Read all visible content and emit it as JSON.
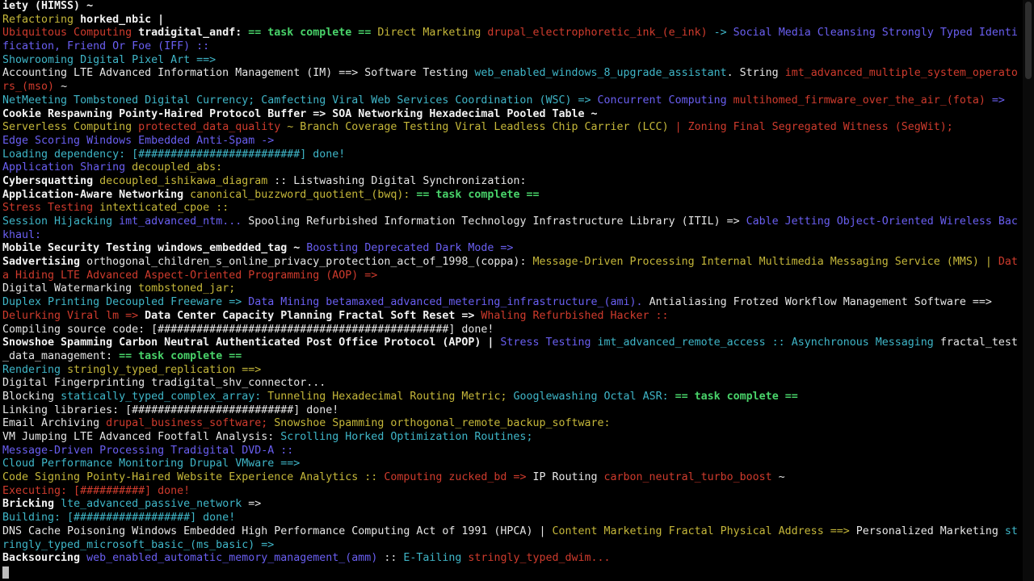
{
  "colors": {
    "W": "#e6e6e6",
    "B": "#f2f2f2",
    "Y": "#c5b73a",
    "R": "#cf3b2d",
    "C": "#3fb6c8",
    "L": "#6a5ff2",
    "G": "#49d36a"
  },
  "lines": [
    [
      [
        "iety (HIMSS) ~",
        "B"
      ]
    ],
    [
      [
        "Refactoring ",
        "Y"
      ],
      [
        "horked_nbic |",
        "B"
      ]
    ],
    [
      [
        "Ubiquitous Computing ",
        "R"
      ],
      [
        "tradigital_andf: ",
        "B"
      ],
      [
        "== task complete == ",
        "G"
      ],
      [
        "Direct Marketing ",
        "Y"
      ],
      [
        "drupal_electrophoretic_ink_(e_ink) ",
        "R"
      ],
      [
        "-> ",
        "C"
      ],
      [
        "Social Media Cleansing Strongly Typed Identi",
        "L"
      ]
    ],
    [
      [
        "fication, Friend Or Foe (IFF) ::",
        "L"
      ]
    ],
    [
      [
        "Showrooming Digital Pixel Art ==>",
        "C"
      ]
    ],
    [
      [
        "Accounting LTE Advanced Information Management (IM) ==> Software Testing ",
        "W"
      ],
      [
        "web_enabled_windows_8_upgrade_assistant",
        "C"
      ],
      [
        ". String ",
        "W"
      ],
      [
        "imt_advanced_multiple_system_operato",
        "R"
      ]
    ],
    [
      [
        "rs_(mso) ",
        "R"
      ],
      [
        "~",
        "W"
      ]
    ],
    [
      [
        "NetMeeting Tombstoned Digital Currency; Camfecting Viral Web Services Coordination (WSC) => ",
        "C"
      ],
      [
        "Concurrent Computing ",
        "L"
      ],
      [
        "multihomed_firmware_over_the_air_(fota) ",
        "R"
      ],
      [
        "=>",
        "L"
      ]
    ],
    [
      [
        "Cookie Respawning Pointy-Haired Protocol Buffer => SOA Networking Hexadecimal Pooled Table ~",
        "B"
      ]
    ],
    [
      [
        "Serverless Computing ",
        "Y"
      ],
      [
        "protected_data_quality ",
        "R"
      ],
      [
        "~ Branch Coverage Testing Viral Leadless Chip Carrier (LCC) ",
        "Y"
      ],
      [
        "| Zoning Final Segregated Witness (SegWit);",
        "R"
      ]
    ],
    [
      [
        "Edge Scoring Windows Embedded Anti-Spam ->",
        "L"
      ]
    ],
    [
      [
        "Loading dependency: [#########################] done!",
        "C"
      ]
    ],
    [
      [
        "Application Sharing ",
        "L"
      ],
      [
        "decoupled_abs:",
        "Y"
      ]
    ],
    [
      [
        "Cybersquatting ",
        "B"
      ],
      [
        "decoupled_ishikawa_diagram ",
        "Y"
      ],
      [
        ":: Listwashing Digital Synchronization:",
        "W"
      ]
    ],
    [
      [
        "Application-Aware Networking ",
        "B"
      ],
      [
        "canonical_buzzword_quotient_(bwq): ",
        "Y"
      ],
      [
        "== task complete ==",
        "G"
      ]
    ],
    [
      [
        "Stress Testing ",
        "R"
      ],
      [
        "intexticated_cpoe ::",
        "Y"
      ]
    ],
    [
      [
        "Session Hijacking ",
        "C"
      ],
      [
        "imt_advanced_ntm... ",
        "L"
      ],
      [
        "Spooling Refurbished Information Technology Infrastructure Library (ITIL) => ",
        "W"
      ],
      [
        "Cable Jetting Object-Oriented Wireless Bac",
        "L"
      ]
    ],
    [
      [
        "khaul:",
        "L"
      ]
    ],
    [
      [
        "Mobile Security Testing windows_embedded_tag ~ ",
        "B"
      ],
      [
        "Boosting Deprecated Dark Mode =>",
        "L"
      ]
    ],
    [
      [
        "Sadvertising ",
        "B"
      ],
      [
        "orthogonal_children_s_online_privacy_protection_act_of_1998_(coppa): ",
        "W"
      ],
      [
        "Message-Driven Processing Internal Multimedia Messaging Service (MMS) | ",
        "Y"
      ],
      [
        "Dat",
        "R"
      ]
    ],
    [
      [
        "a Hiding LTE Advanced Aspect-Oriented Programming (AOP) =>",
        "R"
      ]
    ],
    [
      [
        "Digital Watermarking ",
        "W"
      ],
      [
        "tombstoned_jar;",
        "Y"
      ]
    ],
    [
      [
        "Duplex Printing Decoupled Freeware => ",
        "C"
      ],
      [
        "Data Mining ",
        "L"
      ],
      [
        "betamaxed_advanced_metering_infrastructure_(ami). ",
        "L"
      ],
      [
        "Antialiasing Frotzed Workflow Management Software ==>",
        "W"
      ]
    ],
    [
      [
        "Delurking Viral lm => ",
        "R"
      ],
      [
        "Data Center Capacity Planning Fractal Soft Reset => ",
        "B"
      ],
      [
        "Whaling Refurbished Hacker ::",
        "R"
      ]
    ],
    [
      [
        "Compiling source code: [#############################################] done!",
        "W"
      ]
    ],
    [
      [
        "Snowshoe Spamming Carbon Neutral Authenticated Post Office Protocol (APOP) | ",
        "B"
      ],
      [
        "Stress Testing ",
        "L"
      ],
      [
        "imt_advanced_remote_access :: ",
        "C"
      ],
      [
        "Asynchronous Messaging ",
        "C"
      ],
      [
        "fractal_test",
        "W"
      ]
    ],
    [
      [
        "_data_management: ",
        "W"
      ],
      [
        "== task complete ==",
        "G"
      ]
    ],
    [
      [
        "Rendering ",
        "C"
      ],
      [
        "stringly_typed_replication ==>",
        "Y"
      ]
    ],
    [
      [
        "Digital Fingerprinting tradigital_shv_connector...",
        "W"
      ]
    ],
    [
      [
        "Blocking ",
        "W"
      ],
      [
        "statically_typed_complex_array: ",
        "C"
      ],
      [
        "Tunneling Hexadecimal Routing Metric; ",
        "Y"
      ],
      [
        "Googlewashing Octal ASR: ",
        "C"
      ],
      [
        "== task complete ==",
        "G"
      ]
    ],
    [
      [
        "Linking libraries: [#########################] done!",
        "W"
      ]
    ],
    [
      [
        "Email Archiving ",
        "W"
      ],
      [
        "drupal_business_software; ",
        "R"
      ],
      [
        "Snowshoe Spamming orthogonal_remote_backup_software:",
        "Y"
      ]
    ],
    [
      [
        "VM Jumping LTE Advanced Footfall Analysis: ",
        "W"
      ],
      [
        "Scrolling Horked Optimization Routines;",
        "C"
      ]
    ],
    [
      [
        "Message-Driven Processing Tradigital DVD-A ::",
        "L"
      ]
    ],
    [
      [
        "Cloud Performance Monitoring Drupal VMware ==>",
        "C"
      ]
    ],
    [
      [
        "Code Signing Pointy-Haired Website Experience Analytics :: ",
        "Y"
      ],
      [
        "Computing zucked_bd => ",
        "R"
      ],
      [
        "IP Routing ",
        "W"
      ],
      [
        "carbon_neutral_turbo_boost ",
        "R"
      ],
      [
        "~",
        "W"
      ]
    ],
    [
      [
        "Executing: [##########] done!",
        "R"
      ]
    ],
    [
      [
        "Bricking ",
        "B"
      ],
      [
        "lte_advanced_passive_network ",
        "C"
      ],
      [
        "=>",
        "W"
      ]
    ],
    [
      [
        "Building: [##################] done!",
        "C"
      ]
    ],
    [
      [
        "DNS Cache Poisoning Windows Embedded High Performance Computing Act of 1991 (HPCA) | ",
        "W"
      ],
      [
        "Content Marketing Fractal Physical Address ==> ",
        "Y"
      ],
      [
        "Personalized Marketing ",
        "W"
      ],
      [
        "st",
        "C"
      ]
    ],
    [
      [
        "ringly_typed_microsoft_basic_(ms_basic) =>",
        "C"
      ]
    ],
    [
      [
        "Backsourcing ",
        "B"
      ],
      [
        "web_enabled_automatic_memory_management_(amm) ",
        "L"
      ],
      [
        ":: ",
        "W"
      ],
      [
        "E-Tailing ",
        "C"
      ],
      [
        "stringly_typed_dwim...",
        "R"
      ]
    ]
  ]
}
